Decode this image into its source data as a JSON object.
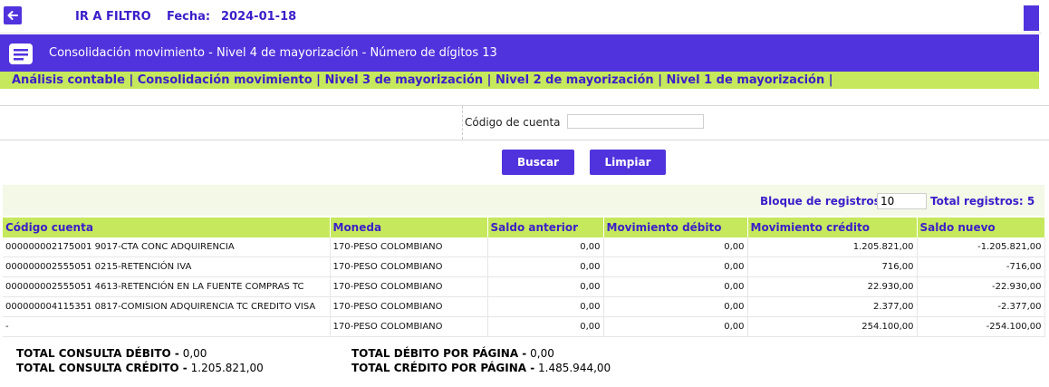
{
  "topbar": {
    "back_icon": "arrow-left-icon",
    "ir_filtro": "IR A FILTRO",
    "fecha_label": "Fecha:",
    "fecha_value": "2024-01-18"
  },
  "header": {
    "icon": "document-list-icon",
    "title": "Consolidación movimiento - Nivel 4 de mayorización - Número de dígitos 13"
  },
  "breadcrumb": [
    {
      "label": "Análisis contable"
    },
    {
      "label": "Consolidación movimiento"
    },
    {
      "label": "Nivel 3 de mayorización"
    },
    {
      "label": "Nivel 2 de mayorización"
    },
    {
      "label": "Nivel 1 de mayorización"
    }
  ],
  "breadcrumb_separator": " | ",
  "filter": {
    "codigo_label": "Código de cuenta",
    "codigo_value": ""
  },
  "buttons": {
    "buscar": "Buscar",
    "limpiar": "Limpiar"
  },
  "results": {
    "bloque_label": "Bloque de registros:",
    "bloque_value": "10",
    "total_registros": "Total registros: 5",
    "columns": [
      "Código cuenta",
      "Moneda",
      "Saldo anterior",
      "Movimiento débito",
      "Movimiento crédito",
      "Saldo nuevo"
    ],
    "rows": [
      [
        "000000002175001 9017-CTA CONC ADQUIRENCIA",
        "170-PESO COLOMBIANO",
        "0,00",
        "0,00",
        "1.205.821,00",
        "-1.205.821,00"
      ],
      [
        "000000002555051 0215-RETENCIÓN IVA",
        "170-PESO COLOMBIANO",
        "0,00",
        "0,00",
        "716,00",
        "-716,00"
      ],
      [
        "000000002555051 4613-RETENCIÓN EN LA FUENTE COMPRAS TC",
        "170-PESO COLOMBIANO",
        "0,00",
        "0,00",
        "22.930,00",
        "-22.930,00"
      ],
      [
        "000000004115351 0817-COMISION ADQUIRENCIA TC CREDITO VISA",
        "170-PESO COLOMBIANO",
        "0,00",
        "0,00",
        "2.377,00",
        "-2.377,00"
      ],
      [
        "-",
        "170-PESO COLOMBIANO",
        "0,00",
        "0,00",
        "254.100,00",
        "-254.100,00"
      ]
    ]
  },
  "totals": {
    "consulta_debito_label": "TOTAL CONSULTA DÉBITO -",
    "consulta_debito_value": "0,00",
    "consulta_credito_label": "TOTAL CONSULTA CRÉDITO -",
    "consulta_credito_value": "1.205.821,00",
    "debito_pagina_label": "TOTAL DÉBITO POR PÁGINA -",
    "debito_pagina_value": "0,00",
    "credito_pagina_label": "TOTAL CRÉDITO POR PÁGINA -",
    "credito_pagina_value": "1.485.944,00"
  },
  "colors": {
    "primary": "#5133dd",
    "accent_green": "#c5e85d",
    "link": "#3b1ec9"
  }
}
